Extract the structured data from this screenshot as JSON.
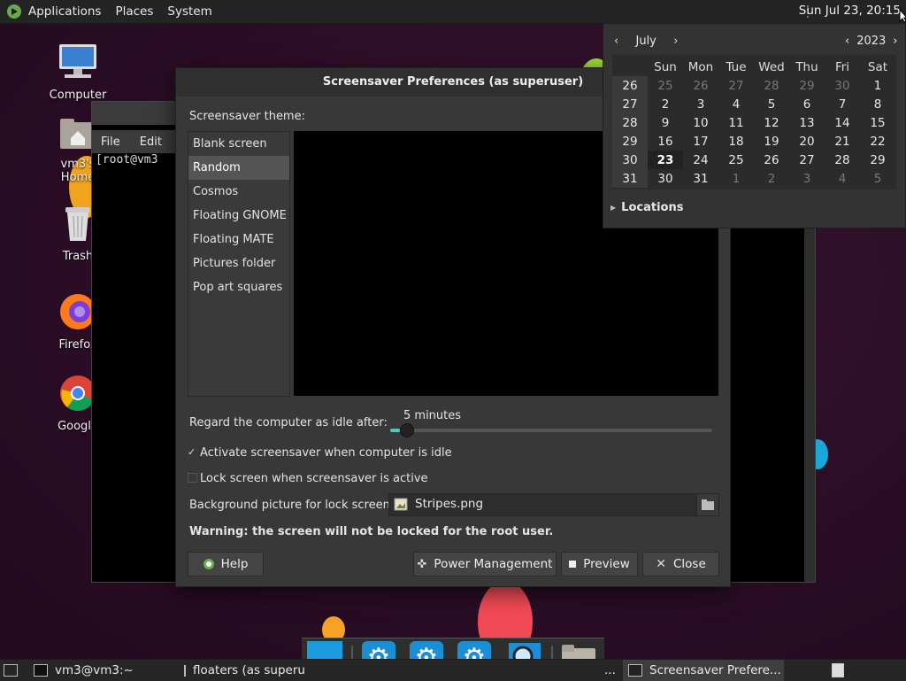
{
  "top_panel": {
    "menus": [
      "Applications",
      "Places",
      "System"
    ],
    "clock": "Sun Jul 23, 20:15"
  },
  "desktop_icons": [
    {
      "label": "Computer",
      "icon": "computer-icon"
    },
    {
      "label": "vm3's Home",
      "icon": "home-folder-icon"
    },
    {
      "label": "Trash",
      "icon": "trash-icon"
    },
    {
      "label": "Firefox",
      "icon": "firefox-icon"
    },
    {
      "label": "Google",
      "icon": "chrome-icon"
    }
  ],
  "terminal": {
    "menus": [
      "File",
      "Edit"
    ],
    "prompt": "[root@vm3"
  },
  "dialog": {
    "title": "Screensaver Preferences (as superuser)",
    "theme_label": "Screensaver theme:",
    "themes": [
      "Blank screen",
      "Random",
      "Cosmos",
      "Floating GNOME",
      "Floating MATE",
      "Pictures folder",
      "Pop art squares"
    ],
    "selected_theme": "Random",
    "idle_label": "Regard the computer as idle after:",
    "idle_value": "5 minutes",
    "idle_fraction": 0.03,
    "activate_label": "Activate screensaver when computer is idle",
    "activate_checked": true,
    "lock_label": "Lock screen when screensaver is active",
    "lock_checked": false,
    "bg_label": "Background picture for lock screen:",
    "bg_file": "Stripes.png",
    "warning": "Warning: the screen will not be locked for the root user.",
    "buttons": {
      "help": "Help",
      "power": "Power Management",
      "preview": "Preview",
      "close": "Close"
    }
  },
  "calendar": {
    "month": "July",
    "year": "2023",
    "weekdays": [
      "Sun",
      "Mon",
      "Tue",
      "Wed",
      "Thu",
      "Fri",
      "Sat"
    ],
    "weeks": [
      {
        "week": "26",
        "days": [
          "25",
          "26",
          "27",
          "28",
          "29",
          "30",
          "1"
        ],
        "dim": [
          0,
          1,
          2,
          3,
          4,
          5
        ]
      },
      {
        "week": "27",
        "days": [
          "2",
          "3",
          "4",
          "5",
          "6",
          "7",
          "8"
        ],
        "dim": []
      },
      {
        "week": "28",
        "days": [
          "9",
          "10",
          "11",
          "12",
          "13",
          "14",
          "15"
        ],
        "dim": []
      },
      {
        "week": "29",
        "days": [
          "16",
          "17",
          "18",
          "19",
          "20",
          "21",
          "22"
        ],
        "dim": []
      },
      {
        "week": "30",
        "days": [
          "23",
          "24",
          "25",
          "26",
          "27",
          "28",
          "29"
        ],
        "dim": [],
        "today": 0
      },
      {
        "week": "31",
        "days": [
          "30",
          "31",
          "1",
          "2",
          "3",
          "4",
          "5"
        ],
        "dim": [
          2,
          3,
          4,
          5,
          6
        ]
      }
    ],
    "locations_label": "Locations"
  },
  "bottom_panel": {
    "tasks": [
      "vm3@vm3:~",
      "floaters (as superu",
      "...",
      "Screensaver Prefere..."
    ]
  },
  "colors": {
    "accent": "#4cc9c0",
    "dock_blue": "#1c8ed6"
  }
}
